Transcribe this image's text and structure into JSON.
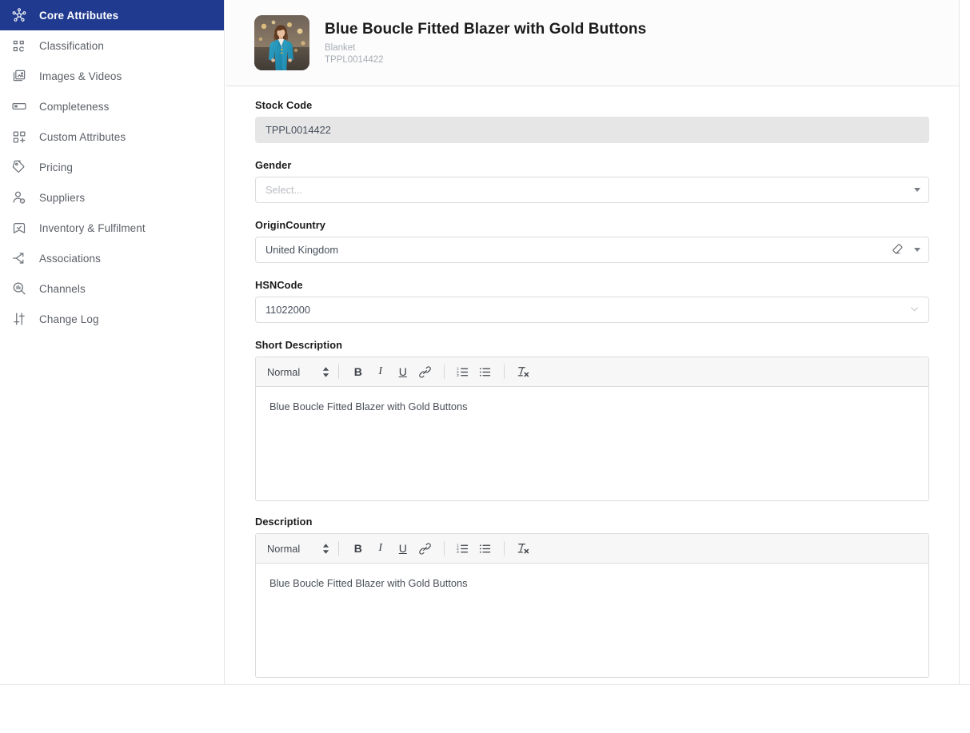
{
  "sidebar": {
    "items": [
      {
        "label": "Core Attributes",
        "icon": "network-node-icon",
        "active": true
      },
      {
        "label": "Classification",
        "icon": "grid-blocks-icon",
        "active": false
      },
      {
        "label": "Images & Videos",
        "icon": "image-stack-icon",
        "active": false
      },
      {
        "label": "Completeness",
        "icon": "progress-bar-icon",
        "active": false
      },
      {
        "label": "Custom Attributes",
        "icon": "grid-plus-icon",
        "active": false
      },
      {
        "label": "Pricing",
        "icon": "price-tag-icon",
        "active": false
      },
      {
        "label": "Suppliers",
        "icon": "user-badge-icon",
        "active": false
      },
      {
        "label": "Inventory & Fulfilment",
        "icon": "box-check-icon",
        "active": false
      },
      {
        "label": "Associations",
        "icon": "arrows-split-icon",
        "active": false
      },
      {
        "label": "Channels",
        "icon": "search-chart-icon",
        "active": false
      },
      {
        "label": "Change Log",
        "icon": "sliders-icon",
        "active": false
      }
    ]
  },
  "product_header": {
    "title": "Blue Boucle Fitted Blazer with Gold Buttons",
    "category": "Blanket",
    "sku": "TPPL0014422",
    "thumbnail_alt": "woman-in-blue-blazer-photo"
  },
  "form": {
    "stock_code": {
      "label": "Stock Code",
      "value": "TPPL0014422",
      "readonly": true
    },
    "gender": {
      "label": "Gender",
      "value": "",
      "placeholder": "Select..."
    },
    "origin_country": {
      "label": "OriginCountry",
      "value": "United Kingdom"
    },
    "hsn_code": {
      "label": "HSNCode",
      "value": "11022000"
    },
    "short_description": {
      "label": "Short Description",
      "format": "Normal",
      "content": "Blue Boucle Fitted Blazer with Gold Buttons"
    },
    "description": {
      "label": "Description",
      "format": "Normal",
      "content": "Blue Boucle Fitted Blazer with Gold Buttons"
    }
  },
  "editor_toolbar": {
    "bold": "B",
    "italic": "I",
    "underline": "U",
    "link": "link-icon",
    "ordered_list": "ordered-list-icon",
    "bullet_list": "bullet-list-icon",
    "clear_format": "clear-formatting-icon"
  },
  "colors": {
    "active_nav_bg": "#203a8f",
    "nav_text": "#5b5f66",
    "label_text": "#1b1b1b",
    "readonly_bg": "#e6e6e6",
    "border": "#dcdcdc",
    "toolbar_bg": "#f7f7f7",
    "placeholder": "#b9bcc2"
  }
}
